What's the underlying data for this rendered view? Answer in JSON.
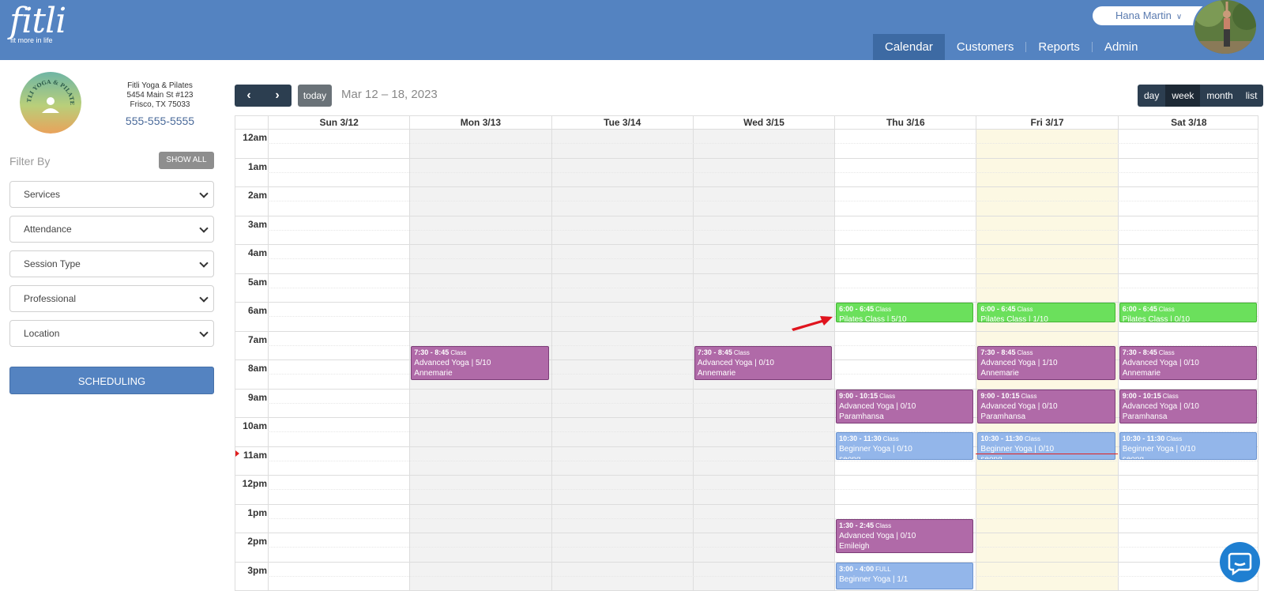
{
  "brand": {
    "name": "fitli",
    "tagline": "fit more in life"
  },
  "user": {
    "name": "Hana Martin"
  },
  "nav": [
    {
      "label": "Calendar",
      "active": true
    },
    {
      "label": "Customers",
      "active": false
    },
    {
      "label": "Reports",
      "active": false
    },
    {
      "label": "Admin",
      "active": false
    }
  ],
  "business": {
    "logo_text": "FITLI YOGA & PILATES",
    "name": "Fitli Yoga & Pilates",
    "address1": "5454 Main St #123",
    "address2": "Frisco, TX 75033",
    "phone": "555-555-5555"
  },
  "filters": {
    "label": "Filter By",
    "show_all": "SHOW ALL",
    "selects": [
      "Services",
      "Attendance",
      "Session Type",
      "Professional",
      "Location"
    ]
  },
  "scheduling_button": "SCHEDULING",
  "toolbar": {
    "prev_icon": "‹",
    "next_icon": "›",
    "today": "today",
    "range": "Mar 12 – 18, 2023",
    "views": [
      {
        "label": "day",
        "active": false
      },
      {
        "label": "week",
        "active": true
      },
      {
        "label": "month",
        "active": false
      },
      {
        "label": "list",
        "active": false
      }
    ]
  },
  "calendar": {
    "days": [
      {
        "label": "Sun 3/12",
        "state": "normal"
      },
      {
        "label": "Mon 3/13",
        "state": "past"
      },
      {
        "label": "Tue 3/14",
        "state": "past"
      },
      {
        "label": "Wed 3/15",
        "state": "past"
      },
      {
        "label": "Thu 3/16",
        "state": "normal"
      },
      {
        "label": "Fri 3/17",
        "state": "today"
      },
      {
        "label": "Sat 3/18",
        "state": "normal"
      }
    ],
    "hours": [
      "12am",
      "1am",
      "2am",
      "3am",
      "4am",
      "5am",
      "6am",
      "7am",
      "8am",
      "9am",
      "10am",
      "11am",
      "12pm",
      "1pm",
      "2pm",
      "3pm"
    ],
    "now_hour": 11.25,
    "events": [
      {
        "day": 4,
        "start": 6,
        "end": 6.75,
        "time": "6:00 - 6:45",
        "tag": "Class",
        "title": "Pilates Class | 5/10",
        "pro": "",
        "color": "green"
      },
      {
        "day": 5,
        "start": 6,
        "end": 6.75,
        "time": "6:00 - 6:45",
        "tag": "Class",
        "title": "Pilates Class | 1/10",
        "pro": "",
        "color": "green"
      },
      {
        "day": 6,
        "start": 6,
        "end": 6.75,
        "time": "6:00 - 6:45",
        "tag": "Class",
        "title": "Pilates Class | 0/10",
        "pro": "",
        "color": "green"
      },
      {
        "day": 1,
        "start": 7.5,
        "end": 8.75,
        "time": "7:30 - 8:45",
        "tag": "Class",
        "title": "Advanced Yoga | 5/10",
        "pro": "Annemarie",
        "color": "purple"
      },
      {
        "day": 3,
        "start": 7.5,
        "end": 8.75,
        "time": "7:30 - 8:45",
        "tag": "Class",
        "title": "Advanced Yoga | 0/10",
        "pro": "Annemarie",
        "color": "purple"
      },
      {
        "day": 5,
        "start": 7.5,
        "end": 8.75,
        "time": "7:30 - 8:45",
        "tag": "Class",
        "title": "Advanced Yoga | 1/10",
        "pro": "Annemarie",
        "color": "purple"
      },
      {
        "day": 6,
        "start": 7.5,
        "end": 8.75,
        "time": "7:30 - 8:45",
        "tag": "Class",
        "title": "Advanced Yoga | 0/10",
        "pro": "Annemarie",
        "color": "purple"
      },
      {
        "day": 4,
        "start": 9,
        "end": 10.25,
        "time": "9:00 - 10:15",
        "tag": "Class",
        "title": "Advanced Yoga | 0/10",
        "pro": "Paramhansa",
        "color": "purple"
      },
      {
        "day": 5,
        "start": 9,
        "end": 10.25,
        "time": "9:00 - 10:15",
        "tag": "Class",
        "title": "Advanced Yoga | 0/10",
        "pro": "Paramhansa",
        "color": "purple"
      },
      {
        "day": 6,
        "start": 9,
        "end": 10.25,
        "time": "9:00 - 10:15",
        "tag": "Class",
        "title": "Advanced Yoga | 0/10",
        "pro": "Paramhansa",
        "color": "purple"
      },
      {
        "day": 4,
        "start": 10.5,
        "end": 11.5,
        "time": "10:30 - 11:30",
        "tag": "Class",
        "title": "Beginner Yoga | 0/10",
        "pro": "seong",
        "color": "blue"
      },
      {
        "day": 5,
        "start": 10.5,
        "end": 11.5,
        "time": "10:30 - 11:30",
        "tag": "Class",
        "title": "Beginner Yoga | 0/10",
        "pro": "seong",
        "color": "blue"
      },
      {
        "day": 6,
        "start": 10.5,
        "end": 11.5,
        "time": "10:30 - 11:30",
        "tag": "Class",
        "title": "Beginner Yoga | 0/10",
        "pro": "seong",
        "color": "blue"
      },
      {
        "day": 4,
        "start": 13.5,
        "end": 14.75,
        "time": "1:30 - 2:45",
        "tag": "Class",
        "title": "Advanced Yoga | 0/10",
        "pro": "Emileigh",
        "color": "purple"
      },
      {
        "day": 4,
        "start": 15,
        "end": 16,
        "time": "3:00 - 4:00",
        "tag": "FULL",
        "title": "Beginner Yoga | 1/1",
        "pro": "",
        "color": "blue"
      }
    ]
  }
}
